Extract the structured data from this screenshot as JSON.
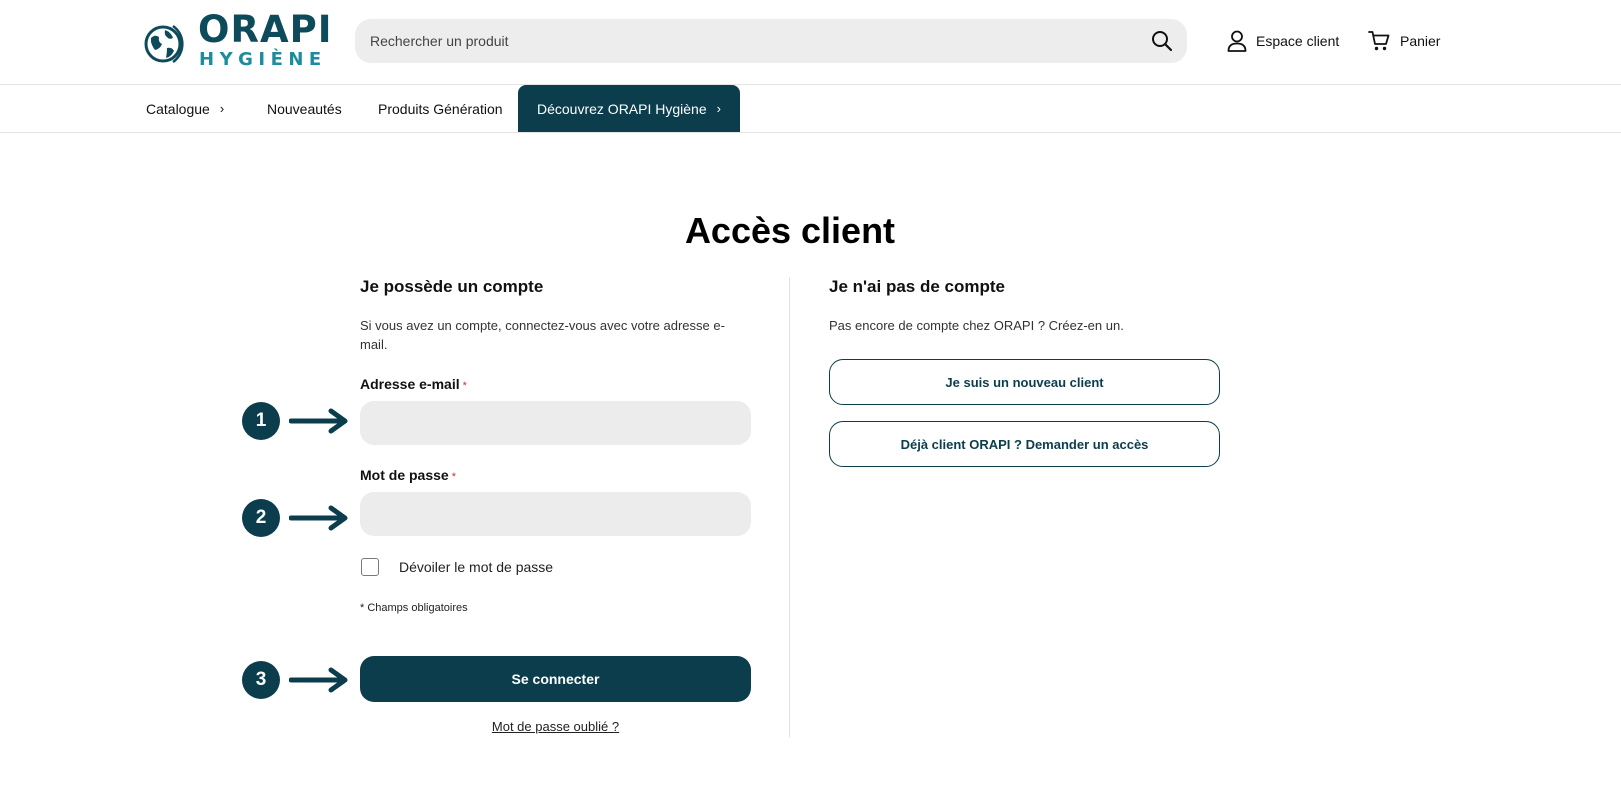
{
  "header": {
    "logo_top": "ORAPI",
    "logo_bottom": "HYGIÈNE",
    "search_placeholder": "Rechercher un produit",
    "account_label": "Espace client",
    "cart_label": "Panier"
  },
  "nav": {
    "items": [
      {
        "label": "Catalogue",
        "chevron": "›"
      },
      {
        "label": "Nouveautés"
      },
      {
        "label": "Produits Génération"
      },
      {
        "label": "Découvrez ORAPI Hygiène",
        "chevron": "›"
      }
    ]
  },
  "main": {
    "title": "Accès client",
    "login": {
      "heading": "Je possède un compte",
      "intro": "Si vous avez un compte, connectez-vous avec votre adresse e-mail.",
      "email_label": "Adresse e-mail",
      "password_label": "Mot de passe",
      "required_mark": "*",
      "show_password_label": "Dévoiler le mot de passe",
      "required_note": "* Champs obligatoires",
      "submit_label": "Se connecter",
      "forgot_label": "Mot de passe oublié ?"
    },
    "register": {
      "heading": "Je n'ai pas de compte",
      "intro": "Pas encore de compte chez ORAPI ? Créez-en un.",
      "new_client_label": "Je suis un nouveau client",
      "existing_client_label": "Déjà client ORAPI ? Demander un accès"
    },
    "steps": [
      "1",
      "2",
      "3"
    ]
  },
  "colors": {
    "brand_dark": "#0c3d4d",
    "brand_teal": "#1d8c9c",
    "input_bg": "#ececec"
  }
}
